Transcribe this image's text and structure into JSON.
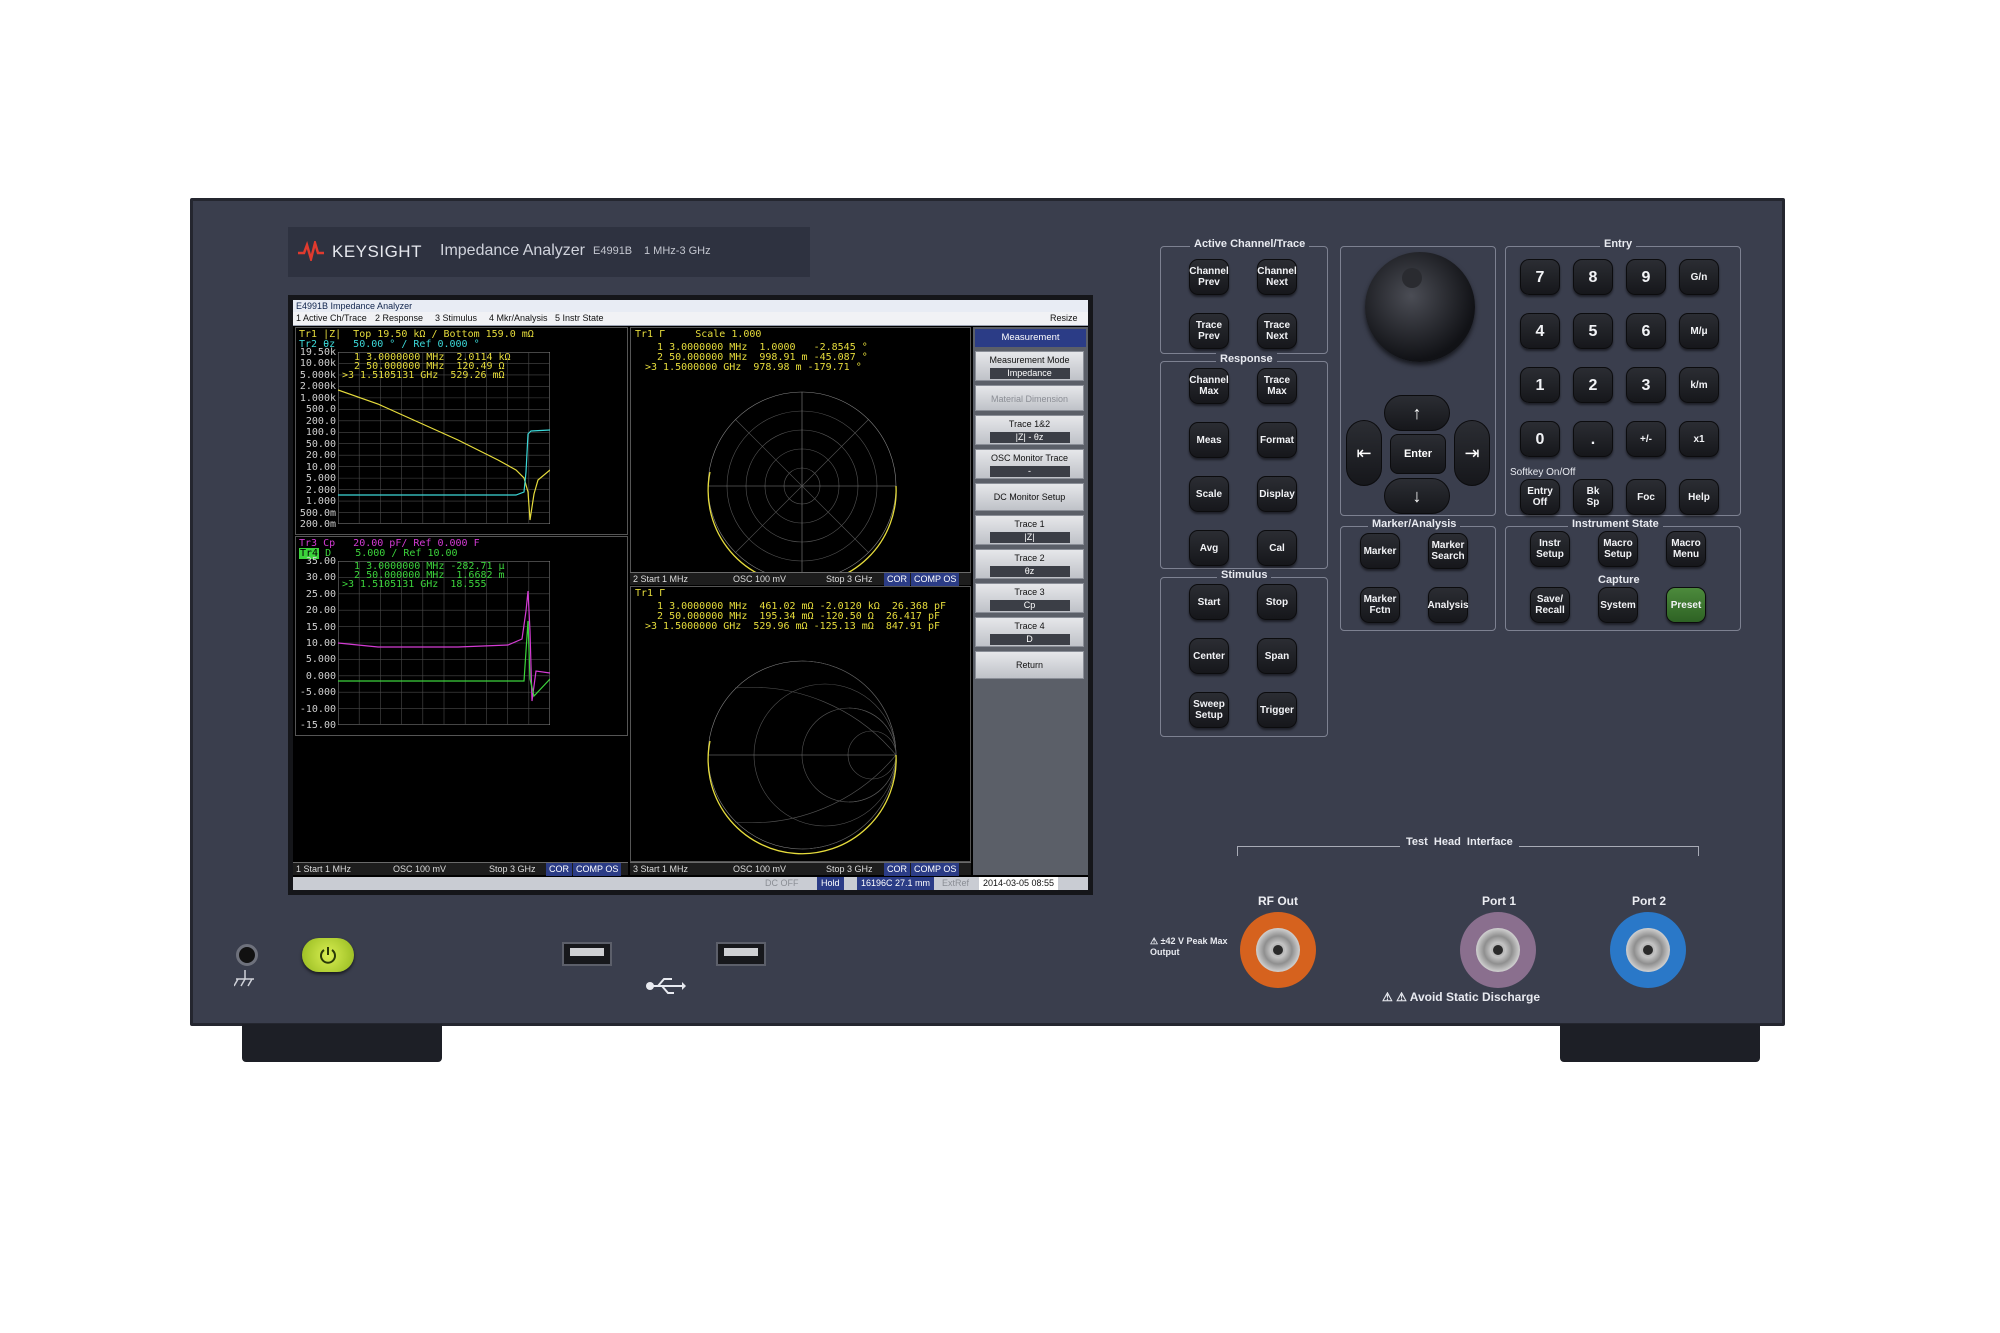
{
  "brand": {
    "name": "KEYSIGHT",
    "product": "Impedance Analyzer",
    "model": "E4991B",
    "range": "1 MHz-3 GHz"
  },
  "screen": {
    "window_title": "E4991B Impedance Analyzer",
    "resize_label": "Resize",
    "menu": [
      "1 Active Ch/Trace",
      "2 Response",
      "3 Stimulus",
      "4 Mkr/Analysis",
      "5 Instr State"
    ],
    "ch1_top": {
      "hdr1": "Tr1 |Z|  Top 19.50 kΩ / Bottom 159.0 mΩ",
      "hdr2": "Tr2 θz   50.00 ° / Ref 0.000 °",
      "markers": [
        "  1 3.0000000 MHz  2.0114 kΩ",
        "  2 50.000000 MHz  120.49 Ω",
        ">3 1.5105131 GHz  529.26 mΩ"
      ],
      "yticks": [
        "19.50k",
        "10.00k",
        "5.000k",
        "2.000k",
        "1.000k",
        "500.0",
        "200.0",
        "100.0",
        "50.00",
        "20.00",
        "10.00",
        "5.000",
        "2.000",
        "1.000",
        "500.0m",
        "200.0m"
      ]
    },
    "ch1_bottom": {
      "hdr1": "Tr3 Cp   20.00 pF/ Ref 0.000 F",
      "hdr2_badge": "Tr4",
      "hdr2": "D    5.000 / Ref 10.00",
      "markers": [
        "  1 3.0000000 MHz -282.71 μ",
        "  2 50.000000 MHz  1.6682 m",
        ">3 1.5105131 GHz  18.555"
      ],
      "yticks": [
        "35.00",
        "30.00",
        "25.00",
        "20.00",
        "15.00",
        "10.00",
        "5.000",
        "0.000",
        "-5.000",
        "-10.00",
        "-15.00"
      ],
      "status": {
        "start": "1 Start 1 MHz",
        "osc": "OSC 100 mV",
        "stop": "Stop 3 GHz",
        "cor": "COR",
        "comp": "COMP OS"
      }
    },
    "ch2": {
      "hdr": "Tr1 Γ     Scale 1.000",
      "markers": [
        "  1 3.0000000 MHz  1.0000   -2.8545 °",
        "  2 50.000000 MHz  998.91 m -45.087 °",
        ">3 1.5000000 GHz  978.98 m -179.71 °"
      ],
      "status": {
        "start": "2 Start 1 MHz",
        "osc": "OSC 100 mV",
        "stop": "Stop 3 GHz",
        "cor": "COR",
        "comp": "COMP OS"
      }
    },
    "ch3": {
      "hdr": "Tr1 Γ",
      "markers": [
        "  1 3.0000000 MHz  461.02 mΩ -2.0120 kΩ  26.368 pF",
        "  2 50.000000 MHz  195.34 mΩ -120.50 Ω  26.417 pF",
        ">3 1.5000000 GHz  529.96 mΩ -125.13 mΩ  847.91 pF"
      ],
      "status": {
        "start": "3 Start 1 MHz",
        "osc": "OSC 100 mV",
        "stop": "Stop 3 GHz",
        "cor": "COR",
        "comp": "COMP OS"
      }
    },
    "softkeys": {
      "title": "Measurement",
      "keys": [
        {
          "label": "Measurement Mode",
          "value": "Impedance"
        },
        {
          "label": "Material Dimension",
          "value": ""
        },
        {
          "label": "Trace 1&2",
          "value": "|Z| - θz"
        },
        {
          "label": "OSC Monitor Trace",
          "value": "-"
        },
        {
          "label": "DC Monitor Setup",
          "value": ""
        },
        {
          "label": "Trace 1",
          "value": "|Z|"
        },
        {
          "label": "Trace 2",
          "value": "θz"
        },
        {
          "label": "Trace 3",
          "value": "Cp"
        },
        {
          "label": "Trace 4",
          "value": "D"
        },
        {
          "label": "Return",
          "value": ""
        }
      ]
    },
    "bottom": {
      "dc": "DC OFF",
      "hold": "Hold",
      "cal": "16196C 27.1 mm",
      "ext": "ExtRef",
      "datetime": "2014-03-05 08:55"
    }
  },
  "panel": {
    "active": {
      "title": "Active Channel/Trace",
      "keys": [
        "Channel\nPrev",
        "Channel\nNext",
        "Trace\nPrev",
        "Trace\nNext"
      ]
    },
    "response": {
      "title": "Response",
      "keys": [
        "Channel\nMax",
        "Trace\nMax",
        "Meas",
        "Format",
        "Scale",
        "Display",
        "Avg",
        "Cal"
      ]
    },
    "stimulus": {
      "title": "Stimulus",
      "keys": [
        "Start",
        "Stop",
        "Center",
        "Span",
        "Sweep\nSetup",
        "Trigger"
      ]
    },
    "navigation": {
      "up": "↑",
      "down": "↓",
      "left": "⇤",
      "right": "⇥",
      "enter": "Enter"
    },
    "marker": {
      "title": "Marker/Analysis",
      "keys": [
        "Marker",
        "Marker\nSearch",
        "Marker\nFctn",
        "Analysis"
      ]
    },
    "entry": {
      "title": "Entry",
      "keys": [
        "7",
        "8",
        "9",
        "G/n",
        "4",
        "5",
        "6",
        "M/μ",
        "1",
        "2",
        "3",
        "k/m",
        "0",
        ".",
        "+/-",
        "x1"
      ],
      "softkey_label": "Softkey On/Off",
      "bottom_keys": [
        "Entry\nOff",
        "Bk\nSp",
        "Foc",
        "Help"
      ]
    },
    "instrument": {
      "title": "Instrument State",
      "keys": [
        "Instr\nSetup",
        "Macro\nSetup",
        "Macro\nMenu"
      ],
      "capture": "Capture",
      "bottom_keys": [
        "Save/\nRecall",
        "System",
        "Preset"
      ]
    },
    "test_head": "Test  Head  Interface",
    "rf_out": "RF Out",
    "port1": "Port 1",
    "port2": "Port 2",
    "peak_warning": "⚠ ±42 V Peak Max\nOutput",
    "static_warning": "⚠ ⚠ Avoid Static Discharge",
    "colors": {
      "trace_yellow": "#e6dc3c",
      "trace_cyan": "#3cd8d8",
      "trace_magenta": "#d43cd4",
      "trace_green": "#3cd43c",
      "preset_green": "#3e7a30",
      "rf_orange": "#d6621e",
      "port1_purple": "#8a6f8e",
      "port2_blue": "#2a78c8"
    }
  }
}
